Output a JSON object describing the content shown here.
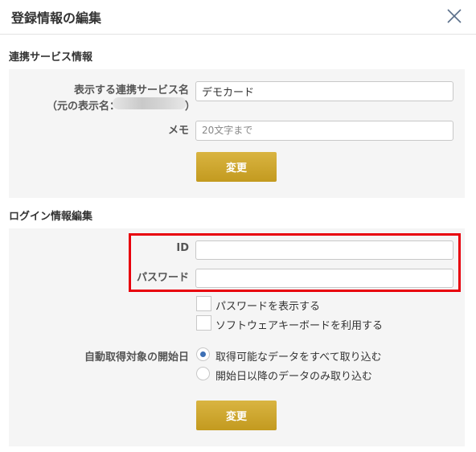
{
  "dialog": {
    "title": "登録情報の編集"
  },
  "service_section": {
    "title": "連携サービス情報",
    "display_name_label": "表示する連携サービス名",
    "original_name_label": "（元の表示名：",
    "original_name_close": "）",
    "display_name_value": "デモカード",
    "memo_label": "メモ",
    "memo_placeholder": "20文字まで",
    "submit_label": "変更"
  },
  "login_section": {
    "title": "ログイン情報編集",
    "id_label": "ID",
    "id_value": "",
    "password_label": "パスワード",
    "password_value": "",
    "show_password_label": "パスワードを表示する",
    "software_keyboard_label": "ソフトウェアキーボードを利用する",
    "start_date_label": "自動取得対象の開始日",
    "options": [
      {
        "label": "取得可能なデータをすべて取り込む",
        "selected": true
      },
      {
        "label": "開始日以降のデータのみ取り込む",
        "selected": false
      }
    ],
    "submit_label": "変更"
  },
  "colors": {
    "button_gold": "#c9a32c",
    "highlight_red": "#e8000c",
    "radio_blue": "#3d6fb5",
    "panel_bg": "#f5f5f5"
  }
}
